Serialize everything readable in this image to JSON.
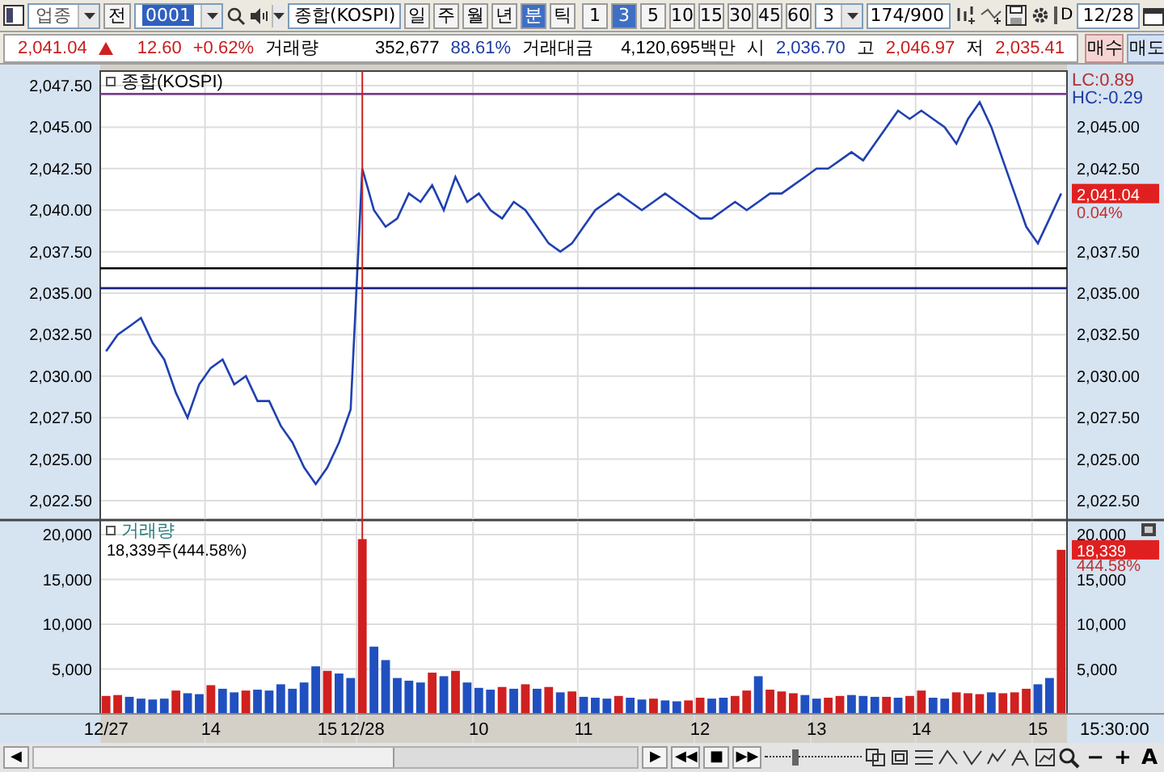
{
  "toolbar": {
    "market_combo": "업종",
    "mode_button": "전",
    "code_field": "0001",
    "name_field": "종합(KOSPI)",
    "period_tabs": [
      {
        "label": "일",
        "selected": false
      },
      {
        "label": "주",
        "selected": false
      },
      {
        "label": "월",
        "selected": false
      },
      {
        "label": "년",
        "selected": false
      },
      {
        "label": "분",
        "selected": true
      },
      {
        "label": "틱",
        "selected": false
      }
    ],
    "interval_buttons": [
      {
        "label": "1",
        "selected": false
      },
      {
        "label": "3",
        "selected": true
      },
      {
        "label": "5",
        "selected": false
      },
      {
        "label": "10",
        "selected": false
      },
      {
        "label": "15",
        "selected": false
      },
      {
        "label": "30",
        "selected": false
      },
      {
        "label": "45",
        "selected": false
      },
      {
        "label": "60",
        "selected": false
      }
    ],
    "interval_combo": "3",
    "count_field": "174/900",
    "d_checkbox": {
      "label": "D",
      "checked": false
    },
    "date_field": "12/28"
  },
  "quote_bar": {
    "price": "2,041.04",
    "change": "12.60",
    "change_pct": "+0.62%",
    "volume_label": "거래량",
    "volume": "352,677",
    "volume_ratio": "88.61%",
    "amount_label": "거래대금",
    "amount": "4,120,695백만",
    "open_label": "시",
    "open": "2,036.70",
    "high_label": "고",
    "high": "2,046.97",
    "low_label": "저",
    "low": "2,035.41",
    "buy_button": "매수",
    "sell_button": "매도"
  },
  "price_panel": {
    "lc": "LC:0.89",
    "hc": "HC:-0.29",
    "current_badge": "2,041.04",
    "current_pct": "0.04%",
    "chart_data": {
      "type": "line",
      "ylim": [
        2021.33,
        2048.38
      ],
      "yticks": [
        {
          "value": 2047.5,
          "label": "2,047.50"
        },
        {
          "value": 2045,
          "label": "2,045.00"
        },
        {
          "value": 2042.5,
          "label": "2,042.50"
        },
        {
          "value": 2040,
          "label": "2,040.00"
        },
        {
          "value": 2037.5,
          "label": "2,037.50"
        },
        {
          "value": 2035,
          "label": "2,035.00"
        },
        {
          "value": 2032.5,
          "label": "2,032.50"
        },
        {
          "value": 2030,
          "label": "2,030.00"
        },
        {
          "value": 2027.5,
          "label": "2,027.50"
        },
        {
          "value": 2025,
          "label": "2,025.00"
        },
        {
          "value": 2022.5,
          "label": "2,022.50"
        }
      ],
      "series": [
        {
          "name": "종합(KOSPI)",
          "color": "#2040b0",
          "values": [
            2031.5,
            2032.5,
            2033,
            2033.5,
            2032,
            2031,
            2029,
            2027.5,
            2029.5,
            2030.5,
            2031,
            2029.5,
            2030,
            2028.5,
            2028.5,
            2027,
            2026,
            2024.5,
            2023.5,
            2024.5,
            2026,
            2028,
            2042.5,
            2040,
            2039,
            2039.5,
            2041,
            2040.5,
            2041.5,
            2040,
            2042,
            2040.5,
            2041,
            2040,
            2039.5,
            2040.5,
            2040,
            2039,
            2038,
            2037.5,
            2038,
            2039,
            2040,
            2040.5,
            2041,
            2040.5,
            2040,
            2040.5,
            2041,
            2040.5,
            2040,
            2039.5,
            2039.5,
            2040,
            2040.5,
            2040,
            2040.5,
            2041,
            2041,
            2041.5,
            2042,
            2042.5,
            2042.5,
            2043,
            2043.5,
            2043,
            2044,
            2045,
            2046,
            2045.5,
            2046,
            2045.5,
            2045,
            2044,
            2045.5,
            2046.5,
            2045,
            2043,
            2041,
            2039,
            2038,
            2039.5,
            2041
          ]
        }
      ],
      "ref_lines": [
        {
          "axis": "y",
          "value": 2047.0,
          "color": "#7a3f8f"
        },
        {
          "axis": "y",
          "value": 2036.5,
          "color": "#000000"
        },
        {
          "axis": "y",
          "value": 2035.3,
          "color": "#1a237e"
        }
      ]
    }
  },
  "volume_panel": {
    "legend_value": "18,339주(444.58%)",
    "current_badge": "18,339",
    "current_pct": "444.58%",
    "chart_data": {
      "type": "bar",
      "ylim": [
        0,
        21622
      ],
      "categories": [
        "12/27",
        null,
        null,
        null,
        null,
        null,
        null,
        null,
        null,
        "14",
        null,
        null,
        null,
        null,
        null,
        null,
        null,
        null,
        null,
        "15",
        null,
        null,
        "12/28",
        null,
        null,
        null,
        null,
        null,
        null,
        null,
        null,
        null,
        "10",
        null,
        null,
        null,
        null,
        null,
        null,
        null,
        null,
        "11",
        null,
        null,
        null,
        null,
        null,
        null,
        null,
        null,
        null,
        "12",
        null,
        null,
        null,
        null,
        null,
        null,
        null,
        null,
        null,
        "13",
        null,
        null,
        null,
        null,
        null,
        null,
        null,
        null,
        "14",
        null,
        null,
        null,
        null,
        null,
        null,
        null,
        null,
        null,
        "15",
        null,
        null
      ],
      "yticks": [
        {
          "value": 20000,
          "label": "20,000"
        },
        {
          "value": 15000,
          "label": "15,000"
        },
        {
          "value": 10000,
          "label": "10,000"
        },
        {
          "value": 5000,
          "label": "5,000"
        }
      ],
      "series": [
        {
          "name": "거래량",
          "color": "#d02020",
          "values": [
            2000,
            2100,
            null,
            null,
            null,
            null,
            2600,
            null,
            null,
            3200,
            null,
            null,
            2600,
            null,
            null,
            null,
            null,
            null,
            null,
            4800,
            null,
            null,
            19500,
            null,
            null,
            null,
            null,
            null,
            4600,
            null,
            4800,
            null,
            null,
            null,
            3000,
            null,
            3300,
            null,
            3000,
            null,
            2500,
            null,
            null,
            null,
            2000,
            null,
            null,
            1700,
            null,
            null,
            1500,
            1800,
            null,
            null,
            2000,
            2600,
            null,
            2700,
            2500,
            2300,
            null,
            null,
            1800,
            2000,
            null,
            null,
            null,
            1900,
            null,
            2000,
            2600,
            null,
            null,
            2400,
            2300,
            2200,
            null,
            2300,
            2400,
            2800,
            null,
            null,
            18300
          ]
        },
        {
          "color": "#2050c0",
          "values": [
            null,
            null,
            1900,
            1700,
            1600,
            1700,
            null,
            2300,
            2200,
            null,
            2800,
            2400,
            null,
            2700,
            2600,
            3300,
            2800,
            3500,
            5300,
            null,
            4500,
            4000,
            null,
            7500,
            6000,
            4000,
            3700,
            3500,
            null,
            4200,
            null,
            3500,
            2900,
            2700,
            null,
            2800,
            null,
            2800,
            null,
            2400,
            null,
            1900,
            1800,
            1700,
            null,
            1800,
            1600,
            null,
            1500,
            1400,
            null,
            null,
            1700,
            1800,
            null,
            null,
            4200,
            null,
            null,
            null,
            2100,
            1700,
            null,
            null,
            2100,
            2000,
            1900,
            null,
            1800,
            null,
            null,
            1800,
            1700,
            null,
            null,
            null,
            2400,
            null,
            null,
            null,
            3300,
            4000,
            null
          ]
        }
      ],
      "ref_lines": [
        {
          "axis": "x",
          "value": "12/28",
          "color": "#cc2222"
        }
      ]
    },
    "end_time": "15:30:00"
  },
  "bottom_bar": {
    "scroll_left": "◀",
    "nav_buttons": [
      "▶",
      "◀◀",
      "■",
      "▶▶"
    ],
    "zoom_slider": {
      "level": 0.3
    },
    "zoom_out": "−",
    "zoom_in": "+",
    "font_button": "A"
  }
}
